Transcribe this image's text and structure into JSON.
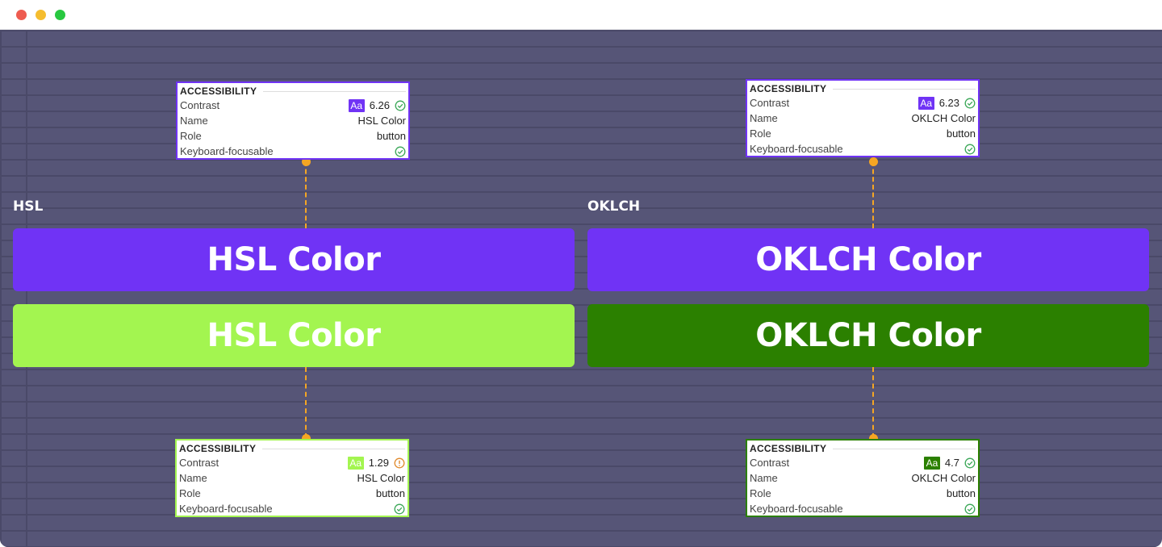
{
  "window": {
    "controls": [
      "close",
      "minimize",
      "maximize"
    ]
  },
  "colors": {
    "background": "#565577",
    "mortar": "#4a4968",
    "hsl_primary": "#7033f5",
    "hsl_secondary": "#a3f550",
    "oklch_primary": "#7033f5",
    "oklch_secondary": "#2b8000",
    "connector": "#f5a623",
    "pass": "#3aa757",
    "warn": "#e08a2c"
  },
  "hsl": {
    "label": "HSL",
    "primary_button": "HSL Color",
    "secondary_button": "HSL Color"
  },
  "oklch": {
    "label": "OKLCH",
    "primary_button": "OKLCH Color",
    "secondary_button": "OKLCH Color"
  },
  "panels": {
    "hsl_top": {
      "header": "ACCESSIBILITY",
      "contrast_label": "Contrast",
      "aa": "Aa",
      "contrast_value": "6.26",
      "contrast_status": "pass",
      "name_label": "Name",
      "name_value": "HSL Color",
      "role_label": "Role",
      "role_value": "button",
      "keyboard_label": "Keyboard-focusable",
      "keyboard_status": "pass"
    },
    "oklch_top": {
      "header": "ACCESSIBILITY",
      "contrast_label": "Contrast",
      "aa": "Aa",
      "contrast_value": "6.23",
      "contrast_status": "pass",
      "name_label": "Name",
      "name_value": "OKLCH Color",
      "role_label": "Role",
      "role_value": "button",
      "keyboard_label": "Keyboard-focusable",
      "keyboard_status": "pass"
    },
    "hsl_bottom": {
      "header": "ACCESSIBILITY",
      "contrast_label": "Contrast",
      "aa": "Aa",
      "contrast_value": "1.29",
      "contrast_status": "warning",
      "name_label": "Name",
      "name_value": "HSL Color",
      "role_label": "Role",
      "role_value": "button",
      "keyboard_label": "Keyboard-focusable",
      "keyboard_status": "pass"
    },
    "oklch_bottom": {
      "header": "ACCESSIBILITY",
      "contrast_label": "Contrast",
      "aa": "Aa",
      "contrast_value": "4.7",
      "contrast_status": "pass",
      "name_label": "Name",
      "name_value": "OKLCH Color",
      "role_label": "Role",
      "role_value": "button",
      "keyboard_label": "Keyboard-focusable",
      "keyboard_status": "pass"
    }
  }
}
